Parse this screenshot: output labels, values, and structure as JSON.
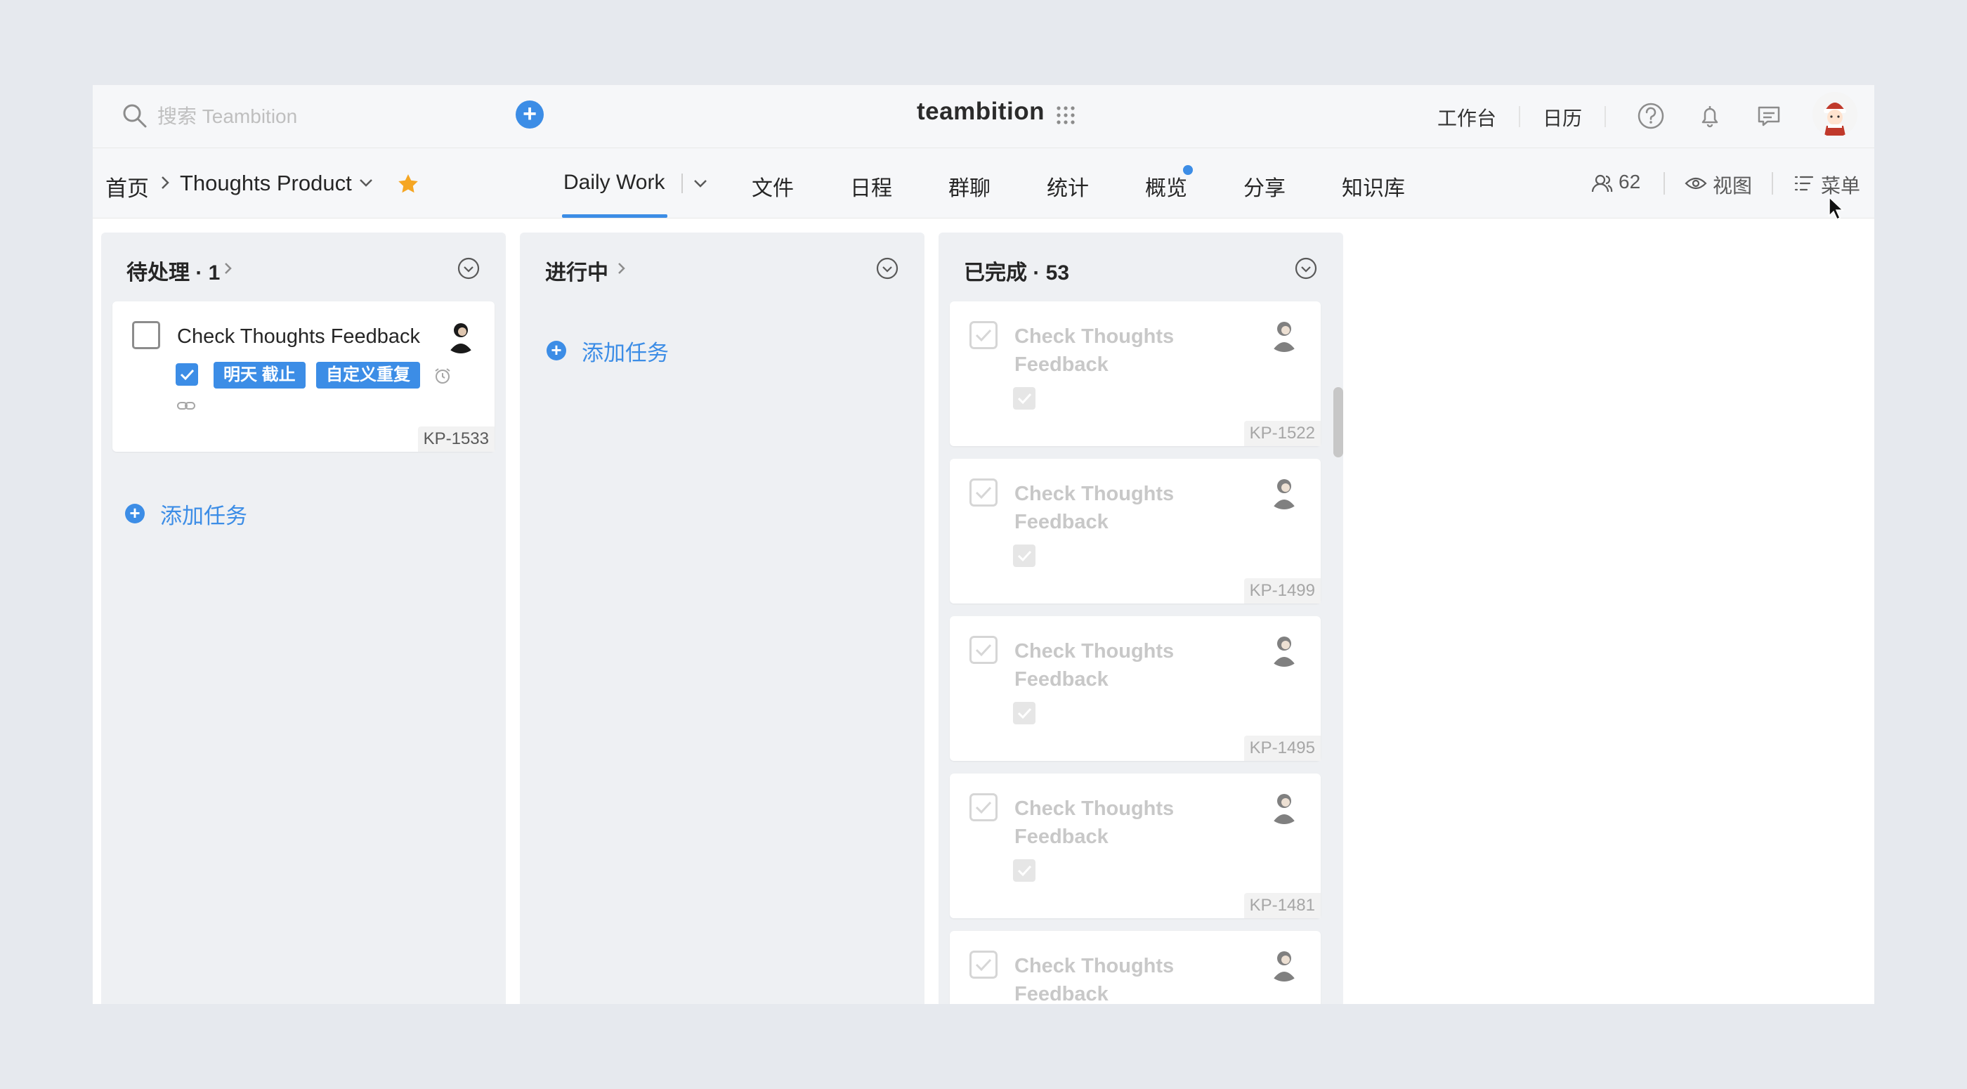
{
  "search": {
    "placeholder": "搜索 Teambition"
  },
  "brand": {
    "logo": "teambition"
  },
  "topbar": {
    "workbench": "工作台",
    "calendar": "日历"
  },
  "breadcrumb": {
    "home": "首页",
    "project": "Thoughts Product"
  },
  "tabs": [
    {
      "label": "Daily Work",
      "active": true
    },
    {
      "label": "文件"
    },
    {
      "label": "日程"
    },
    {
      "label": "群聊"
    },
    {
      "label": "统计"
    },
    {
      "label": "概览",
      "has_dot": true
    },
    {
      "label": "分享"
    },
    {
      "label": "知识库"
    }
  ],
  "nav_right": {
    "members_count": "62",
    "view_label": "视图",
    "menu_label": "菜单"
  },
  "columns": [
    {
      "title": "待处理 · 1",
      "add_label": "添加任务",
      "cards": [
        {
          "title": "Check Thoughts Feedback",
          "tags": [
            "明天 截止",
            "自定义重复"
          ],
          "id": "KP-1533"
        }
      ]
    },
    {
      "title": "进行中",
      "add_label": "添加任务",
      "cards": []
    },
    {
      "title": "已完成 · 53",
      "cards": [
        {
          "title_line1": "Check Thoughts",
          "title_line2": "Feedback",
          "id": "KP-1522"
        },
        {
          "title_line1": "Check Thoughts",
          "title_line2": "Feedback",
          "id": "KP-1499"
        },
        {
          "title_line1": "Check Thoughts",
          "title_line2": "Feedback",
          "id": "KP-1495"
        },
        {
          "title_line1": "Check Thoughts",
          "title_line2": "Feedback",
          "id": "KP-1481"
        },
        {
          "title_line1": "Check Thoughts",
          "title_line2": "Feedback"
        }
      ]
    }
  ],
  "colors": {
    "accent": "#3c8de6",
    "star": "#f5a623",
    "background": "#e6e9ee"
  },
  "icons": [
    "search-icon",
    "plus-icon",
    "grid-icon",
    "help-icon",
    "bell-icon",
    "message-icon",
    "chevron-down-icon",
    "star-icon",
    "people-icon",
    "eye-icon",
    "list-icon",
    "circle-chevron-icon",
    "alarm-icon",
    "link-icon"
  ]
}
